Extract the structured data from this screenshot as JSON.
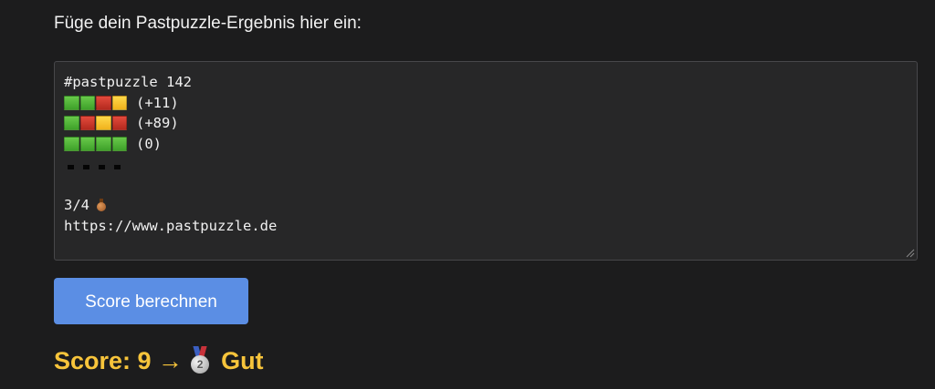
{
  "prompt": {
    "label": "Füge dein Pastpuzzle-Ergebnis hier ein:"
  },
  "result_input": {
    "header": "#pastpuzzle 142",
    "rows": [
      {
        "squares": [
          "green",
          "green",
          "red",
          "yellow"
        ],
        "text": "(+11)"
      },
      {
        "squares": [
          "green",
          "red",
          "yellow",
          "red"
        ],
        "text": "(+89)"
      },
      {
        "squares": [
          "green",
          "green",
          "green",
          "green"
        ],
        "text": "(0)"
      }
    ],
    "empty_row_marker": "black-dashes",
    "score_line": "3/4",
    "score_line_icon": "bronze-medal-icon",
    "url": "https://www.pastpuzzle.de"
  },
  "button": {
    "label": "Score berechnen",
    "color": "#5b8ee4"
  },
  "score": {
    "prefix": "Score: 9 →",
    "medal": "2",
    "medal_icon": "silver-medal-icon",
    "label": "Gut",
    "color": "#f7c43b"
  },
  "colors": {
    "background": "#1c1c1d",
    "textarea_background": "#272728",
    "green": "#4cb035",
    "red": "#d03a2d",
    "yellow": "#f8c82c"
  }
}
